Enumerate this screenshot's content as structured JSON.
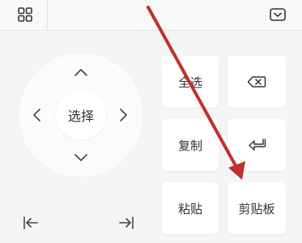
{
  "toolbar": {
    "grid_icon": "grid-icon",
    "collapse_icon": "keyboard-collapse-icon"
  },
  "dpad": {
    "up_icon": "chevron-up-icon",
    "down_icon": "chevron-down-icon",
    "left_icon": "chevron-left-icon",
    "right_icon": "chevron-right-icon",
    "select_label": "选择"
  },
  "cursor": {
    "start_icon": "cursor-to-start-icon",
    "end_icon": "cursor-to-end-icon"
  },
  "keys": {
    "select_all": "全选",
    "delete_icon": "backspace-icon",
    "copy": "复制",
    "enter_icon": "enter-icon",
    "paste": "粘贴",
    "clipboard": "剪贴板"
  },
  "colors": {
    "annotation_arrow": "#c0312b",
    "icon": "#333333",
    "background": "#f5f5f5",
    "key": "#ffffff"
  }
}
